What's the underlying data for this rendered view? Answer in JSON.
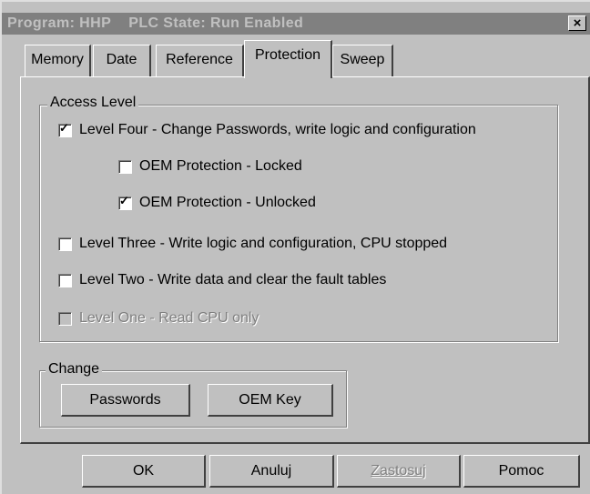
{
  "window": {
    "title": "Program: HHP    PLC State: Run Enabled",
    "close_glyph": "×"
  },
  "tabs": [
    {
      "label": "Memory",
      "selected": false
    },
    {
      "label": "Date",
      "selected": false
    },
    {
      "label": "Reference",
      "selected": false
    },
    {
      "label": "Protection",
      "selected": true
    },
    {
      "label": "Sweep",
      "selected": false
    }
  ],
  "access_level": {
    "title": "Access Level",
    "options": [
      {
        "label": "Level Four - Change Passwords, write logic and configuration",
        "checked": true,
        "enabled": true
      },
      {
        "label": "OEM Protection - Locked",
        "checked": false,
        "enabled": true
      },
      {
        "label": "OEM Protection - Unlocked",
        "checked": true,
        "enabled": true
      },
      {
        "label": "Level Three - Write logic and configuration, CPU stopped",
        "checked": false,
        "enabled": true
      },
      {
        "label": "Level Two - Write data and clear the fault tables",
        "checked": false,
        "enabled": true
      },
      {
        "label": "Level One - Read CPU only",
        "checked": false,
        "enabled": false
      }
    ]
  },
  "change": {
    "title": "Change",
    "passwords_label": "Passwords",
    "oem_key_label": "OEM Key"
  },
  "footer": {
    "ok_label": "OK",
    "cancel_label": "Anuluj",
    "apply_label": "Zastosuj",
    "apply_enabled": false,
    "help_label": "Pomoc"
  },
  "check_glyph": "✓"
}
